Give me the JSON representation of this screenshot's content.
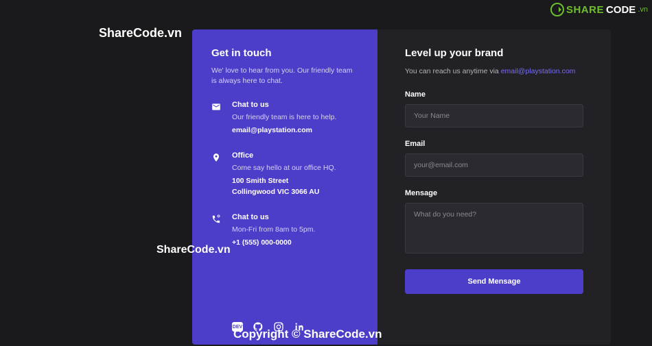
{
  "left": {
    "title": "Get in touch",
    "subtitle": "We' love to hear from you. Our friendly team is always here to chat.",
    "blocks": [
      {
        "heading": "Chat to us",
        "desc": "Our friendly team is here to help.",
        "strong1": "email@playstation.com"
      },
      {
        "heading": "Office",
        "desc": "Come say hello at our office HQ.",
        "strong1": "100 Smith Street",
        "strong2": "Collingwood VIC 3066 AU"
      },
      {
        "heading": "Chat to us",
        "desc": "Mon-Fri from 8am to 5pm.",
        "strong1": "+1 (555) 000-0000"
      }
    ],
    "socials": [
      "dev",
      "github",
      "instagram",
      "linkedin"
    ]
  },
  "right": {
    "title": "Level up your brand",
    "subtitle_prefix": "You can reach us anytime via ",
    "subtitle_link": "email@playstation.com",
    "name_label": "Name",
    "name_placeholder": "Your Name",
    "email_label": "Email",
    "email_placeholder": "your@email.com",
    "message_label": "Mensage",
    "message_placeholder": "What do you need?",
    "submit": "Send Mensage"
  },
  "watermarks": {
    "wm1": "ShareCode.vn",
    "wm2": "ShareCode.vn",
    "wm3": "Copyright © ShareCode.vn",
    "logo_share": "SHARE",
    "logo_code": "CODE",
    "logo_vn": ".vn"
  }
}
